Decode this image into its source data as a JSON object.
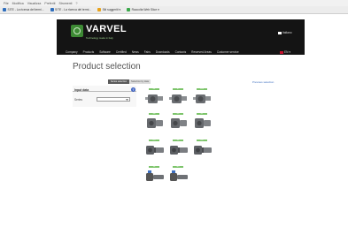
{
  "browser": {
    "menu": [
      "File",
      "Modifica",
      "Visualizza",
      "Preferiti",
      "Strumenti",
      "?"
    ],
    "favorites": [
      {
        "label": "SITE - La ricerca del termi...",
        "color": "#2f6ebd"
      },
      {
        "label": "SITE - La ricerca del termi...",
        "color": "#2f6ebd"
      },
      {
        "label": "Siti suggeriti ▾",
        "color": "#e8a21a"
      },
      {
        "label": "Raccolta Web Slice ▾",
        "color": "#3aa84a"
      }
    ]
  },
  "header": {
    "logo_text": "VARVEL",
    "logo_sub": "Technology made in Italy",
    "top_language": "Italiano",
    "nav": [
      "Company",
      "Products",
      "Software",
      "Certified",
      "News",
      "Fairs",
      "Downloads",
      "Contacts",
      "Reserved Areas",
      "Customer service"
    ],
    "nav_language": "EN ▾",
    "bg_color": "#141414",
    "accent_color": "#3d8a34"
  },
  "main": {
    "title": "Product selection",
    "toggle": {
      "active": "Series selection",
      "inactive": "Selection by data"
    },
    "side_link": "Previous selection"
  },
  "panel": {
    "title": "Input data",
    "help_icon": "?",
    "series_label": "Series",
    "series_value": ""
  },
  "products": [
    {
      "tag": "RS",
      "icon": "gearbox-worm-icon"
    },
    {
      "tag": "RT",
      "icon": "gearbox-worm-icon"
    },
    {
      "tag": "FRS",
      "icon": "gearbox-worm-icon"
    },
    {
      "tag": "RN",
      "icon": "gearbox-inline-icon"
    },
    {
      "tag": "RD",
      "icon": "gearbox-inline-icon"
    },
    {
      "tag": "RP",
      "icon": "gearbox-inline-icon"
    },
    {
      "tag": "RO",
      "icon": "gearbox-motor-icon"
    },
    {
      "tag": "SR",
      "icon": "gearbox-motor-icon"
    },
    {
      "tag": "RG",
      "icon": "gearbox-motor-icon"
    },
    {
      "tag": "VR",
      "icon": "gearmotor-icon"
    },
    {
      "tag": "MO",
      "icon": "gearmotor-icon"
    }
  ]
}
